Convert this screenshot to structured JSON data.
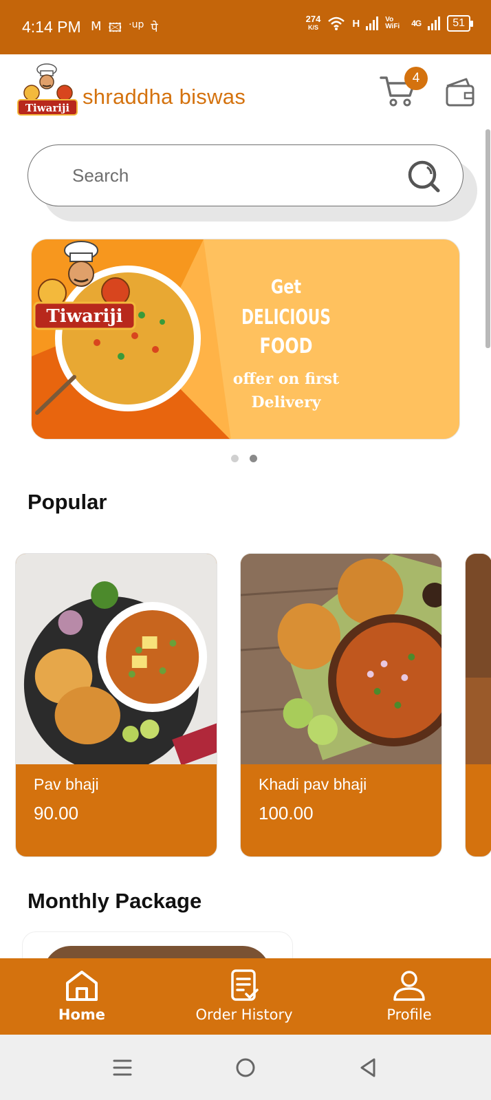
{
  "status_bar": {
    "time": "4:14 PM",
    "left_icons": [
      "gmail-icon",
      "gallery-icon",
      "upi-icon",
      "phonepe-icon"
    ],
    "left_glyphs": [
      "M",
      "🖾",
      "·up",
      "पे"
    ],
    "net_speed_value": "274",
    "net_speed_unit": "K/S",
    "signal_label_1": "H",
    "signal_label_2": "Vo WiFi",
    "signal_label_3": "4G",
    "battery": "51"
  },
  "header": {
    "brand_name": "shraddha biswas",
    "logo_text": "Tiwariji",
    "cart_count": "4"
  },
  "search": {
    "placeholder": "Search"
  },
  "banner": {
    "line1": "Get",
    "line2": "DELICIOUS",
    "line3": "FOOD",
    "line4": "offer on first",
    "line5": "Delivery",
    "logo_text": "Tiwariji",
    "dots_total": 2,
    "active_dot": 2
  },
  "sections": {
    "popular": "Popular",
    "monthly": "Monthly Package"
  },
  "products": [
    {
      "name": "Pav bhaji",
      "price": "90.00"
    },
    {
      "name": "Khadi pav bhaji",
      "price": "100.00"
    }
  ],
  "bottom_nav": {
    "home": "Home",
    "order_history": "Order History",
    "profile": "Profile"
  },
  "colors": {
    "status_bar": "#C4650A",
    "accent": "#D4720E",
    "banner_bg": "#FFC15E"
  }
}
